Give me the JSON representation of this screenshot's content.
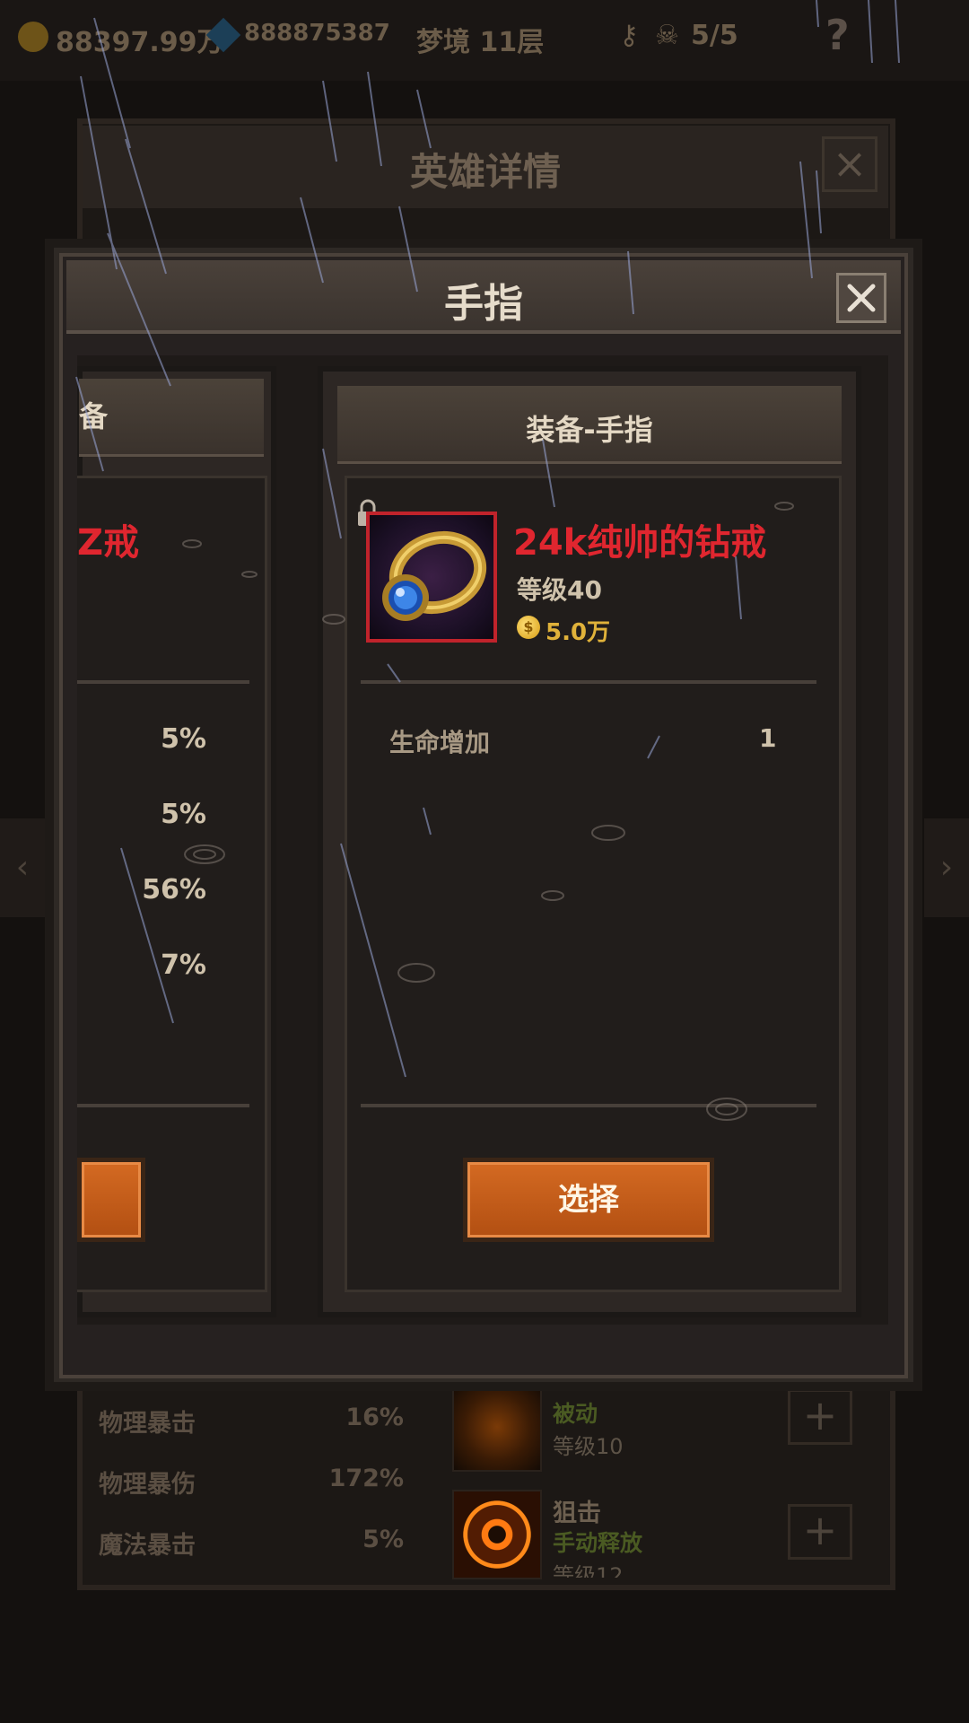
{
  "status_bar": {
    "gold": "88397.99万",
    "gems": "888875387",
    "dungeon": "梦境 11层",
    "skull_count": "5/5",
    "help": "?"
  },
  "background_panel": {
    "title": "英雄详情",
    "stats": [
      {
        "label": "物理暴击",
        "value": "16%"
      },
      {
        "label": "物理暴伤",
        "value": "172%"
      },
      {
        "label": "魔法暴击",
        "value": "5%"
      }
    ],
    "skills": [
      {
        "name": "",
        "type": "被动",
        "level": "等级10"
      },
      {
        "name": "狙击",
        "type": "手动释放",
        "level": "等级12"
      }
    ]
  },
  "popup": {
    "title": "手指",
    "left_card": {
      "header_tail": "备",
      "item_name_tail": "Z戒",
      "percents": [
        "5%",
        "5%",
        "56%",
        "7%"
      ]
    },
    "right_card": {
      "header": "装备-手指",
      "item_name": "24k纯帅的钻戒",
      "level": "等级40",
      "price": "5.0万",
      "attributes": [
        {
          "label": "生命增加",
          "value": "1"
        }
      ],
      "select_label": "选择"
    }
  },
  "colors": {
    "item_name": "#e0262f",
    "button": "#c45c1a",
    "price": "#e0b23a"
  }
}
